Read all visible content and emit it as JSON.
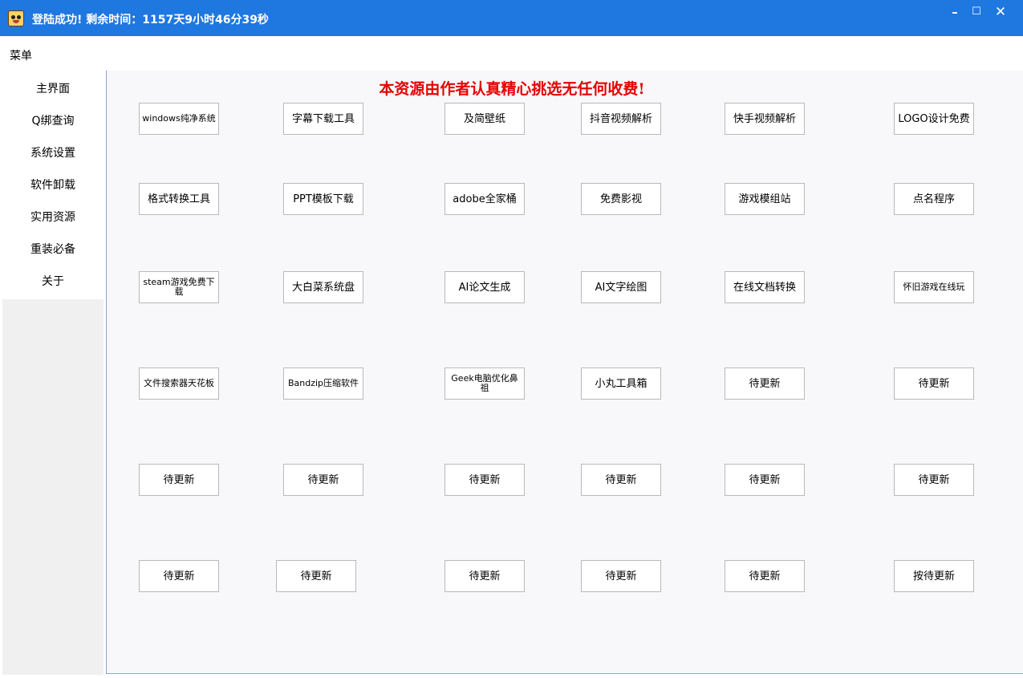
{
  "titlebar": {
    "title": "登陆成功! 剩余时间：1157天9小时46分39秒"
  },
  "menubar": {
    "menu_label": "菜单"
  },
  "sidebar": {
    "items": [
      "主界面",
      "Q绑查询",
      "系统设置",
      "软件卸载",
      "实用资源",
      "重装必备",
      "关于"
    ]
  },
  "main": {
    "banner": "本资源由作者认真精心挑选无任何收费!",
    "rows": [
      [
        "windows纯净系统",
        "字幕下载工具",
        "及简壁纸",
        "抖音视频解析",
        "快手视频解析",
        "LOGO设计免费"
      ],
      [
        "格式转换工具",
        "PPT模板下载",
        "adobe全家桶",
        "免费影视",
        "游戏模组站",
        "点名程序"
      ],
      [
        "steam游戏免费下载",
        "大白菜系统盘",
        "AI论文生成",
        "AI文字绘图",
        "在线文档转换",
        "怀旧游戏在线玩"
      ],
      [
        "文件搜索器天花板",
        "Bandzip压缩软件",
        "Geek电脑优化鼻祖",
        "小丸工具箱",
        "待更新",
        "待更新"
      ],
      [
        "待更新",
        "待更新",
        "待更新",
        "待更新",
        "待更新",
        "待更新"
      ],
      [
        "待更新",
        "待更新",
        "待更新",
        "待更新",
        "待更新",
        "按待更新"
      ]
    ]
  }
}
